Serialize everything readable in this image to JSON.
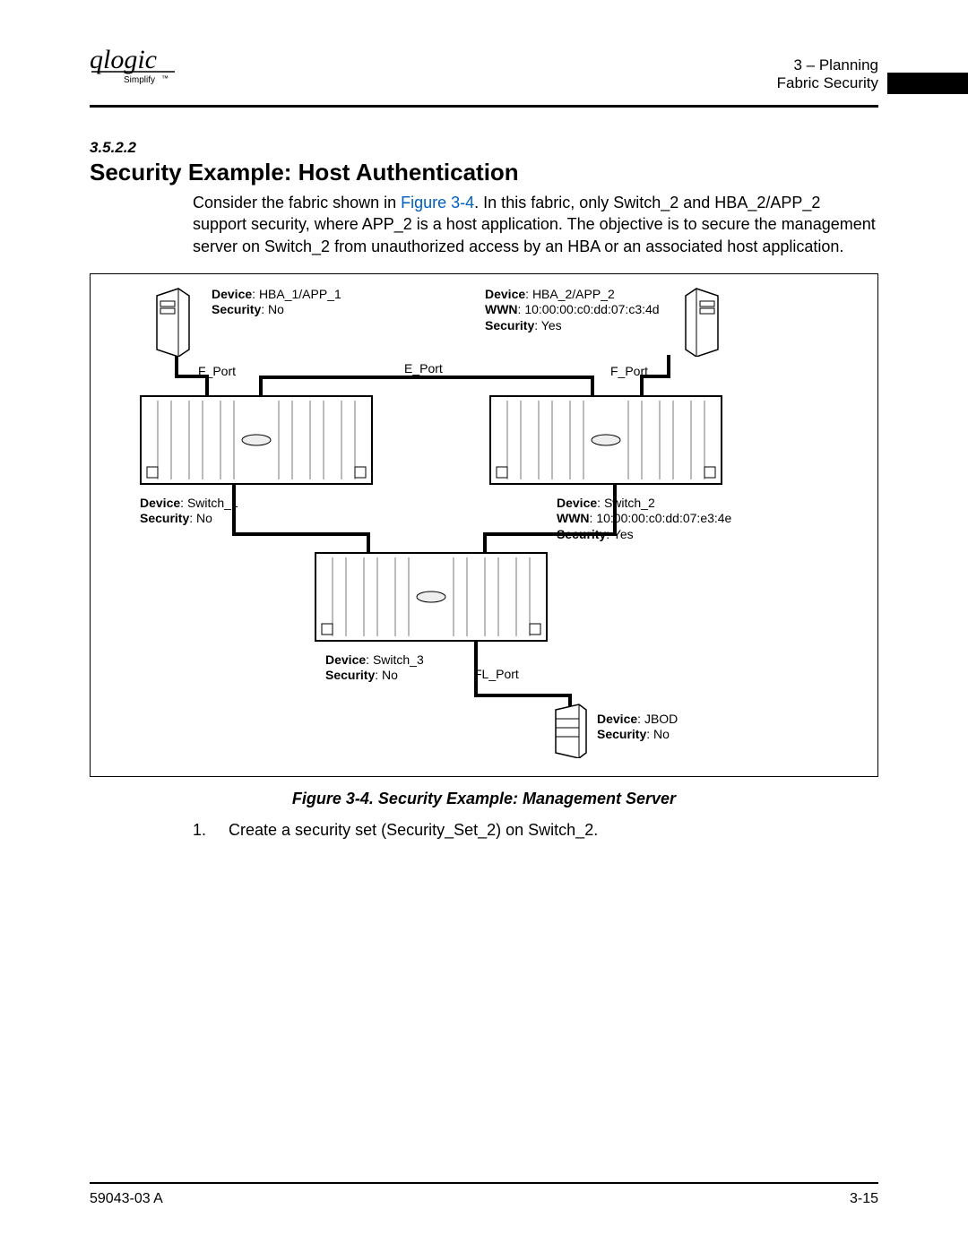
{
  "header": {
    "logo_text": "qlogic",
    "logo_tagline": "Simplify™",
    "right_line1": "3 – Planning",
    "right_line2": "Fabric Security"
  },
  "section": {
    "number": "3.5.2.2",
    "title": "Security Example: Host Authentication",
    "para_pre": "Consider the fabric shown in ",
    "figure_ref": "Figure 3-4",
    "para_post": ". In this fabric, only Switch_2 and HBA_2/APP_2 support security, where APP_2 is a host application. The objective is to secure the management server on Switch_2 from unauthorized access by an HBA or an associated host application."
  },
  "figure": {
    "caption": "Figure 3-4.  Security Example: Management Server",
    "ports": {
      "f_port_left": "F_Port",
      "e_port": "E_Port",
      "f_port_right": "F_Port",
      "fl_port": "FL_Port"
    },
    "devices": {
      "hba1": {
        "label_device": "Device",
        "device": "HBA_1/APP_1",
        "label_security": "Security",
        "security": "No"
      },
      "hba2": {
        "label_device": "Device",
        "device": "HBA_2/APP_2",
        "label_wwn": "WWN",
        "wwn": "10:00:00:c0:dd:07:c3:4d",
        "label_security": "Security",
        "security": "Yes"
      },
      "switch1": {
        "label_device": "Device",
        "device": "Switch_1",
        "label_security": "Security",
        "security": "No"
      },
      "switch2": {
        "label_device": "Device",
        "device": "Switch_2",
        "label_wwn": "WWN",
        "wwn": "10:00:00:c0:dd:07:e3:4e",
        "label_security": "Security",
        "security": "Yes"
      },
      "switch3": {
        "label_device": "Device",
        "device": "Switch_3",
        "label_security": "Security",
        "security": "No"
      },
      "jbod": {
        "label_device": "Device",
        "device": "JBOD",
        "label_security": "Security",
        "security": "No"
      }
    }
  },
  "list": {
    "item1_num": "1.",
    "item1_text": "Create a security set (Security_Set_2) on Switch_2."
  },
  "footer": {
    "left": "59043-03  A",
    "right": "3-15"
  }
}
